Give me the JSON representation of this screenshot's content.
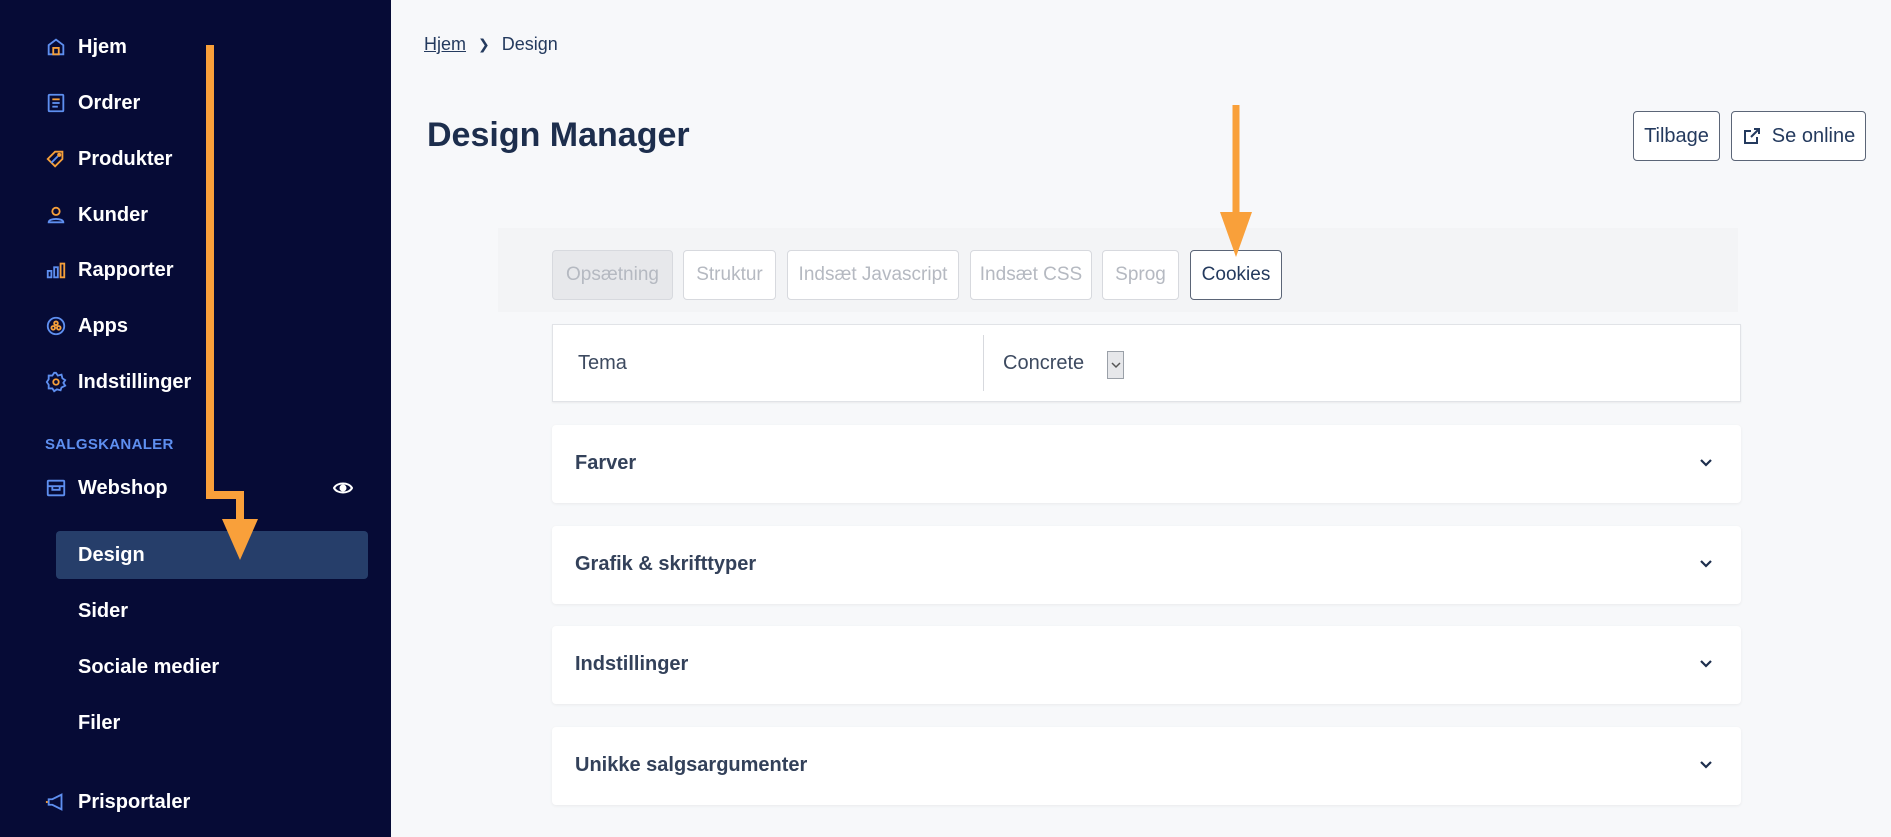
{
  "sidebar": {
    "items": [
      {
        "label": "Hjem",
        "icon": "home-icon"
      },
      {
        "label": "Ordrer",
        "icon": "orders-icon"
      },
      {
        "label": "Produkter",
        "icon": "tag-icon"
      },
      {
        "label": "Kunder",
        "icon": "user-icon"
      },
      {
        "label": "Rapporter",
        "icon": "bar-chart-icon"
      },
      {
        "label": "Apps",
        "icon": "apps-icon"
      },
      {
        "label": "Indstillinger",
        "icon": "gear-icon"
      }
    ],
    "section_label": "SALGSKANALER",
    "webshop": {
      "label": "Webshop",
      "icon": "storefront-icon"
    },
    "sub_items": [
      {
        "label": "Design",
        "active": true
      },
      {
        "label": "Sider"
      },
      {
        "label": "Sociale medier"
      },
      {
        "label": "Filer"
      }
    ],
    "prisportaler": {
      "label": "Prisportaler",
      "icon": "megaphone-icon"
    }
  },
  "breadcrumb": {
    "home": "Hjem",
    "current": "Design"
  },
  "header": {
    "title": "Design Manager",
    "back_label": "Tilbage",
    "online_label": "Se online"
  },
  "tabs": [
    {
      "label": "Opsætning"
    },
    {
      "label": "Struktur"
    },
    {
      "label": "Indsæt Javascript"
    },
    {
      "label": "Indsæt CSS"
    },
    {
      "label": "Sprog"
    },
    {
      "label": "Cookies"
    }
  ],
  "tema": {
    "label": "Tema",
    "value": "Concrete"
  },
  "accordions": [
    {
      "label": "Farver"
    },
    {
      "label": "Grafik & skrifttyper"
    },
    {
      "label": "Indstillinger"
    },
    {
      "label": "Unikke salgsargumenter"
    }
  ],
  "colors": {
    "sidebar_bg": "#060b36",
    "sidebar_active": "#263e6a",
    "accent_blue": "#5e8ff0",
    "icon_orange": "#f6a03a",
    "annotation_arrow": "#f9a03a",
    "title_text": "#1d2e4d"
  }
}
